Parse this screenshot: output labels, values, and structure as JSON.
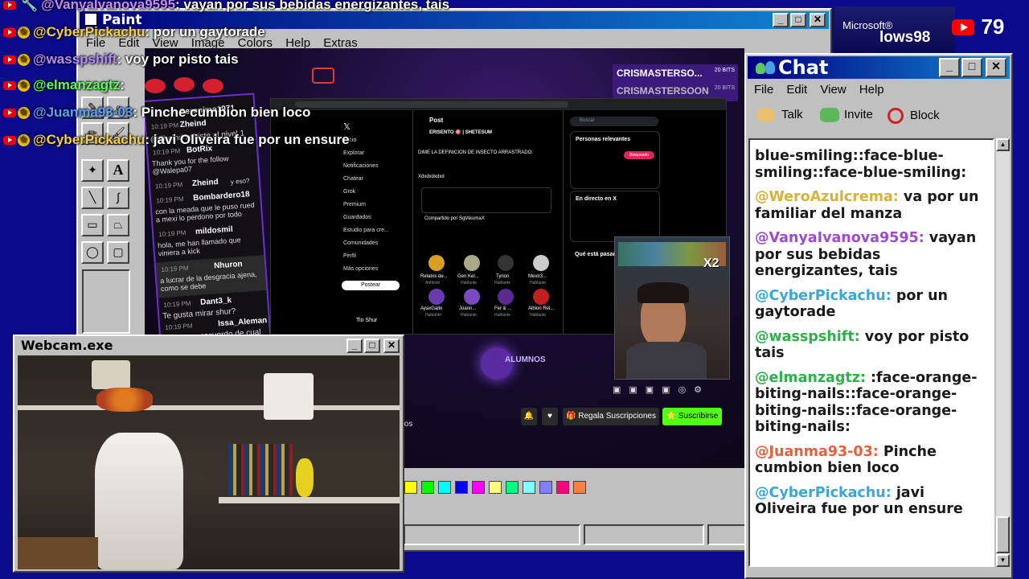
{
  "viewer_count": "79",
  "paint": {
    "title": "Paint",
    "menu": [
      "File",
      "Edit",
      "View",
      "Image",
      "Colors",
      "Help",
      "Extras"
    ]
  },
  "top_right_text": {
    "microsoft": "Microsoft®",
    "windows": "lows98"
  },
  "overlay_chat": [
    {
      "user": "@VanyaIvanova9595",
      "user_color": "#c488ff",
      "text": ": vayan por sus bebidas energizantes, tais"
    },
    {
      "user": "@CyberPickachu",
      "user_color": "#f5d04a",
      "text": ": por un gaytorade"
    },
    {
      "user": "@wasspshift",
      "user_color": "#b88cff",
      "text": ": voy por pisto tais"
    },
    {
      "user": "@elmanzagtz",
      "user_color": "#5aff5a",
      "text": ":"
    },
    {
      "user": "@Juanma93-03",
      "user_color": "#5aa0ff",
      "text": ": Pinche cumbion bien loco"
    },
    {
      "user": "@CyberPickachu",
      "user_color": "#f5d04a",
      "text": ": javi Oliveira fue por un ensure"
    }
  ],
  "chat_window": {
    "title": "Chat",
    "menu": [
      "File",
      "Edit",
      "View",
      "Help"
    ],
    "toolbar": [
      "Talk",
      "Invite",
      "Block"
    ],
    "messages": [
      {
        "user": "",
        "user_color": "#1a1a1a",
        "text": "blue-smiling::face-blue-smiling::face-blue-smiling:"
      },
      {
        "user": "@WeroAzulcrema:",
        "user_color": "#d6b33a",
        "text": "va por un familiar del manza"
      },
      {
        "user": "@VanyaIvanova9595:",
        "user_color": "#9a4cd6",
        "text": "vayan por sus bebidas energizantes, tais"
      },
      {
        "user": "@CyberPickachu:",
        "user_color": "#3aa7d6",
        "text": "por un gaytorade"
      },
      {
        "user": "@wasspshift:",
        "user_color": "#2fb04a",
        "text": "voy por pisto tais"
      },
      {
        "user": "@elmanzagtz:",
        "user_color": "#2fb04a",
        "text": ":face-orange-biting-nails::face-orange-biting-nails::face-orange-biting-nails:"
      },
      {
        "user": "@Juanma93-03:",
        "user_color": "#e8603a",
        "text": "Pinche cumbion bien loco"
      },
      {
        "user": "@CyberPickachu:",
        "user_color": "#3aa7d6",
        "text": "javi Oliveira fue por un ensure"
      }
    ]
  },
  "webcam": {
    "title": "Webcam.exe"
  },
  "stream": {
    "bits": [
      {
        "name": "CRISMASTERSO...",
        "amount": "20 BITS"
      },
      {
        "name": "CRISMASTERSOON",
        "amount": "20 BITS"
      }
    ],
    "side_chat": [
      {
        "name": "Geronimo1971",
        "msg": ""
      },
      {
        "name": "Zheind",
        "msg": ""
      },
      {
        "name": "",
        "msg": "@Zheind subiste al nivel 1"
      },
      {
        "name": "BotRix",
        "msg": "Thank you for the follow @Walepa07"
      },
      {
        "name": "Zheind",
        "msg": "y eso?"
      },
      {
        "name": "Bombardero18",
        "msg": "con la meada que le puso rued a mexi lo perdono por todo"
      },
      {
        "name": "mildosmil",
        "msg": "hola, me han llamado que viniera a kick"
      },
      {
        "name": "Nhuron",
        "msg": "a lucrar de la desgracia ajena, como se debe"
      },
      {
        "name": "Dant3_k",
        "msg": "Te gusta mirar shur?"
      },
      {
        "name": "Issa_Aleman",
        "msg": "recuerdo de cual"
      }
    ],
    "times": [
      "10:19 PM",
      "10:19 PM",
      "10:19 PM",
      "10:19 PM",
      "10:19 PM",
      "10:19 PM",
      "10:19 PM",
      "10:19 PM",
      "10:19 PM"
    ],
    "x_nav": [
      "Inicio",
      "Explorar",
      "Notificaciones",
      "Chatear",
      "Grok",
      "Premium",
      "Guardados",
      "Estudio para cre...",
      "Comunidades",
      "Perfil",
      "Más opciones"
    ],
    "post_button": "Postear",
    "post_header": "Post",
    "post_author": "ERISENTO 🎯 | SHETESUM",
    "post_text": "DIME LA DEFINICION DE INSECTO ARRASTRADO:",
    "post_hashtag": "Xdxdxdxdxd",
    "post_shared": "Compartido por SgtAkumaX",
    "search_placeholder": "Buscar",
    "relevant_header": "Personas relevantes",
    "live_header": "En directo en X",
    "happening_header": "Qué está pasando",
    "follow_label": "Bloqueado",
    "people": [
      {
        "name": "Relatos de...",
        "role": "Anfitrión"
      },
      {
        "name": "Gen Kel...",
        "role": "Hablante"
      },
      {
        "name": "Tyrion",
        "role": "Hablante"
      },
      {
        "name": "Mexir3...",
        "role": "Hablante"
      },
      {
        "name": "AyaxGallo",
        "role": "Hablante"
      },
      {
        "name": "Joann...",
        "role": "Hablante"
      },
      {
        "name": "Fer & ...",
        "role": "Hablante"
      },
      {
        "name": "Albion Rel...",
        "role": "Hablante"
      }
    ],
    "sidebar_user": "Tio Shur",
    "logo_text": "ALUMNOS",
    "gift_button": "Regala Suscripciones",
    "subscribe_button": "Suscribirse",
    "multiplier": "X2",
    "left_partial": "tos"
  }
}
